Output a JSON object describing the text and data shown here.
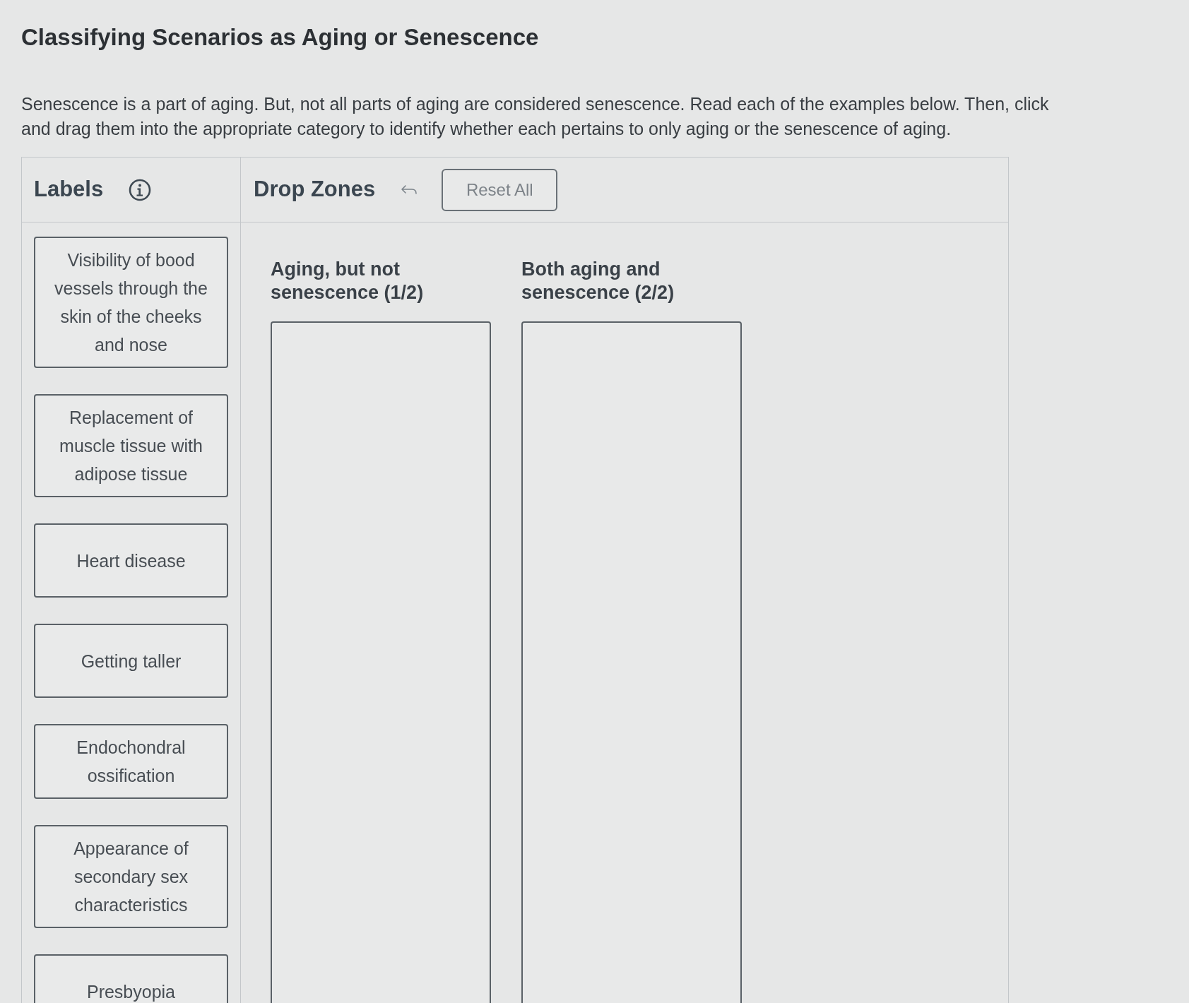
{
  "page": {
    "title": "Classifying Scenarios as Aging or Senescence",
    "instructions": "Senescence is a part of aging. But, not all parts of aging are considered senescence. Read each of the examples below. Then, click and drag them into the appropriate category to identify whether each pertains to only aging or the senescence of aging."
  },
  "labels_panel": {
    "heading": "Labels",
    "labels": [
      "Visibility of bood vessels through the skin of the cheeks and nose",
      "Replacement of muscle tissue with adipose tissue",
      "Heart disease",
      "Getting taller",
      "Endochondral ossification",
      "Appearance of secondary sex characteristics",
      "Presbyopia"
    ]
  },
  "drop_zones_panel": {
    "heading": "Drop Zones",
    "reset_button": "Reset All",
    "zones": [
      {
        "heading": "Aging, but not senescence (1/2)"
      },
      {
        "heading": "Both aging and senescence (2/2)"
      }
    ]
  }
}
